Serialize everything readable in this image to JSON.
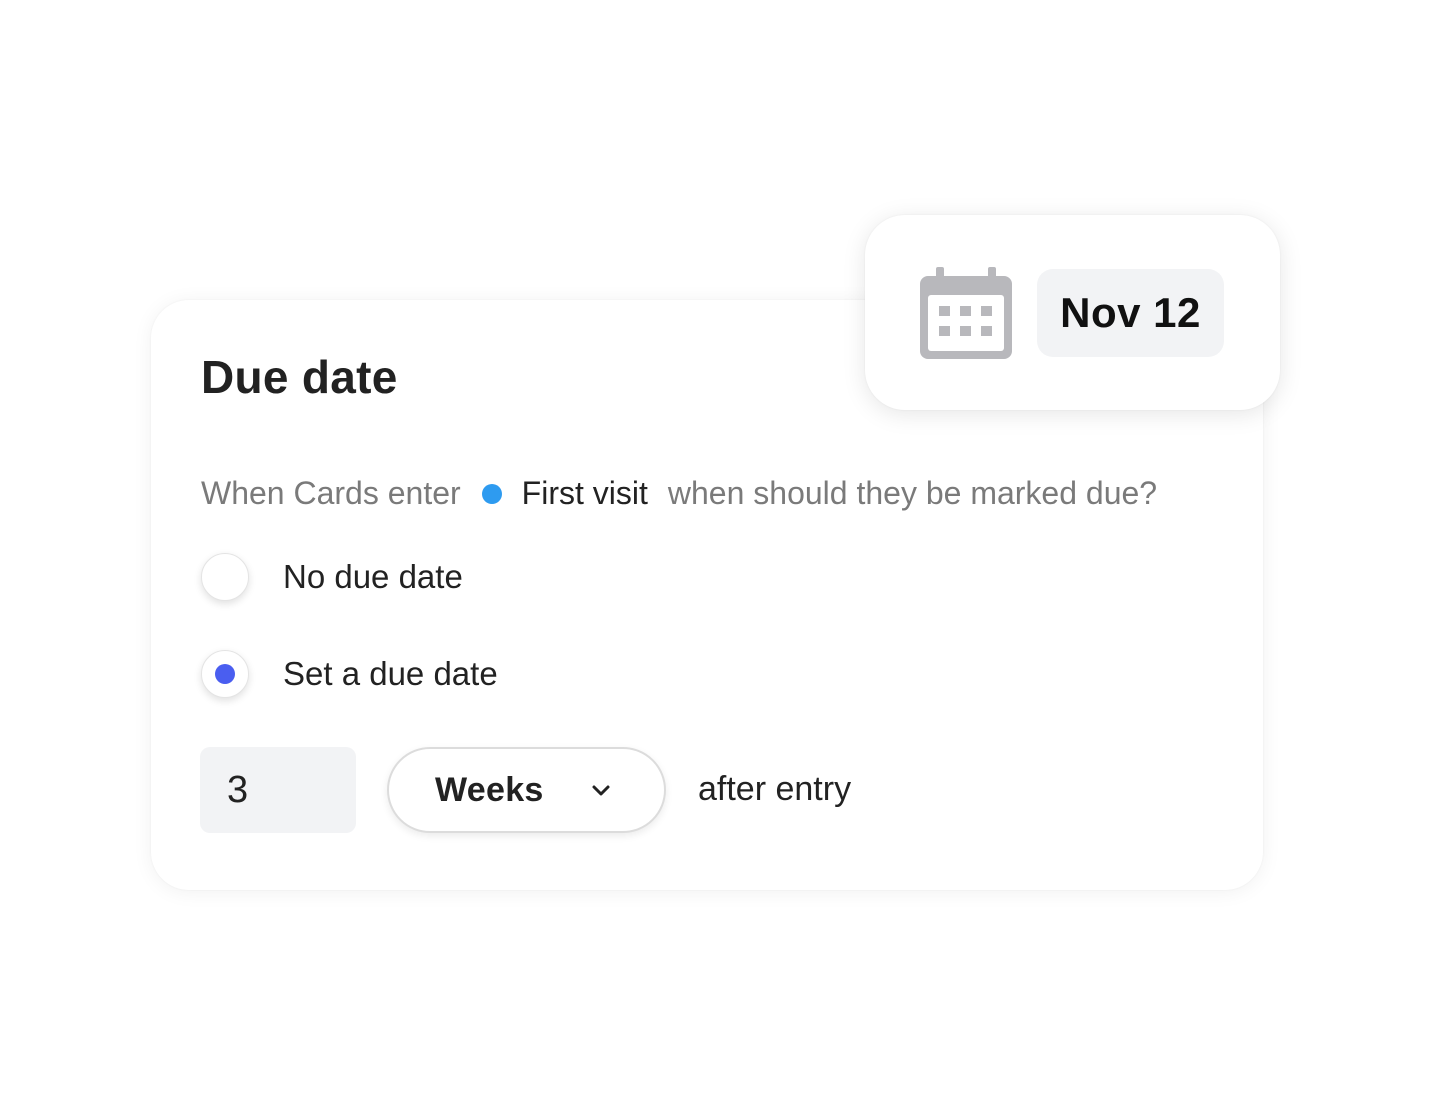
{
  "card": {
    "title": "Due date",
    "question": {
      "prefix": "When Cards enter",
      "stage_name": "First visit",
      "stage_color": "#2e9bf0",
      "suffix": "when should they be marked due?"
    },
    "options": [
      {
        "label": "No due date",
        "selected": false
      },
      {
        "label": "Set a due date",
        "selected": true
      }
    ],
    "radio_selected_color": "#4a5ef0",
    "duration": {
      "amount": "3",
      "unit": "Weeks",
      "after_text": "after entry"
    }
  },
  "popup": {
    "icon": "calendar-icon",
    "date": "Nov 12"
  }
}
